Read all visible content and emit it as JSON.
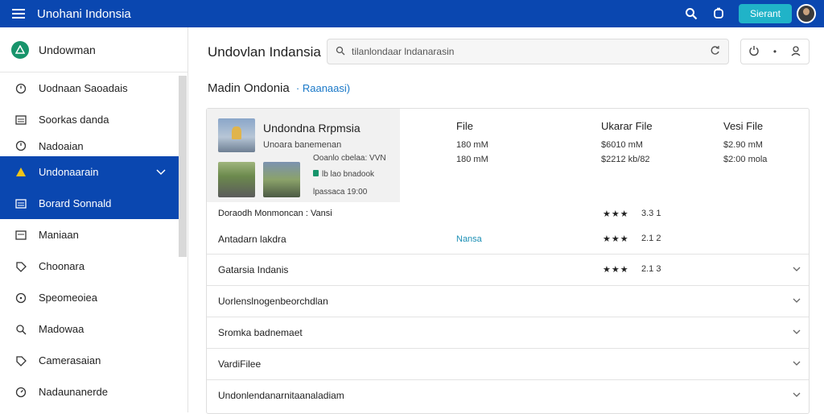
{
  "topbar": {
    "title": "Unohani Indonsia",
    "action_button": "Sierant"
  },
  "sidebar": {
    "brand": "Undowman",
    "items": [
      {
        "label": "Uodnaan Saoadais",
        "icon": "clock-icon"
      },
      {
        "label": "Soorkas danda",
        "icon": "list-icon"
      },
      {
        "label": "Nadoaian",
        "icon": "clock-icon"
      },
      {
        "label": "Undonaarain",
        "icon": "warning-icon",
        "active": true
      },
      {
        "label": "Borard Sonnald",
        "icon": "document-icon",
        "active": true
      },
      {
        "label": "Maniaan",
        "icon": "document-icon"
      },
      {
        "label": "Choonara",
        "icon": "tag-icon"
      },
      {
        "label": "Speomeoiea",
        "icon": "clock-icon"
      },
      {
        "label": "Madowaa",
        "icon": "search-icon"
      },
      {
        "label": "Camerasaian",
        "icon": "tag-icon"
      },
      {
        "label": "Nadaunanerde",
        "icon": "clock-icon"
      }
    ]
  },
  "main": {
    "title": "Undovlan Indansia",
    "search_placeholder": "tilanlondaar lndanarasin",
    "subheading": "Madin Ondonia",
    "subheading_link": "· Raanaasi)",
    "columns": {
      "file": "File",
      "ukarar": "Ukarar File",
      "vesi": "Vesi File"
    },
    "featured": {
      "title": "Undondna Rrpmsia",
      "subtitle": "Unoara banemenan",
      "line1": "Ooanlo cbelaa: VVN",
      "line2": "lb lao bnadook",
      "line3": "lpassaca 19:00",
      "file_values": [
        "180 mM",
        "180 mM"
      ],
      "ukarar_values": [
        "$6010 mM",
        "$2212 kb/82"
      ],
      "vesi_values": [
        "$2.90 mM",
        "$2:00 mola"
      ]
    },
    "rows": [
      {
        "title": "Doraodh Monmoncan : Vansi",
        "stars": "★★★",
        "rating": "3.3 1"
      },
      {
        "title": "Antadarn lakdra",
        "tag": "Nansa",
        "stars": "★★★",
        "rating": "2.1 2"
      },
      {
        "title": "Gatarsia Indanis",
        "stars": "★★★",
        "rating": "2.1 3"
      },
      {
        "title": "Uorlenslnogenbeorchdlan"
      },
      {
        "title": "Sromka badnemaet"
      },
      {
        "title": "VardiFilee"
      },
      {
        "title": "Undonlendanarnitaanaladiam"
      }
    ]
  }
}
